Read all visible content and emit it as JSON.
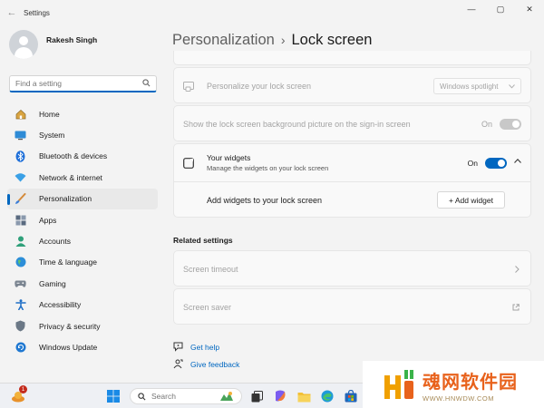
{
  "window": {
    "title": "Settings",
    "controls": [
      "—",
      "▢",
      "✕"
    ]
  },
  "user": {
    "name": "Rakesh Singh"
  },
  "search": {
    "placeholder": "Find a setting"
  },
  "sidebar": {
    "items": [
      {
        "label": "Home",
        "icon": "home-icon"
      },
      {
        "label": "System",
        "icon": "monitor-icon"
      },
      {
        "label": "Bluetooth & devices",
        "icon": "bluetooth-icon"
      },
      {
        "label": "Network & internet",
        "icon": "wifi-icon"
      },
      {
        "label": "Personalization",
        "icon": "brush-icon",
        "active": true
      },
      {
        "label": "Apps",
        "icon": "apps-icon"
      },
      {
        "label": "Accounts",
        "icon": "person-icon"
      },
      {
        "label": "Time & language",
        "icon": "globe-icon"
      },
      {
        "label": "Gaming",
        "icon": "gamepad-icon"
      },
      {
        "label": "Accessibility",
        "icon": "accessibility-icon"
      },
      {
        "label": "Privacy & security",
        "icon": "shield-icon"
      },
      {
        "label": "Windows Update",
        "icon": "update-icon"
      }
    ]
  },
  "breadcrumb": {
    "parent": "Personalization",
    "separator": "›",
    "current": "Lock screen"
  },
  "personalize": {
    "label": "Personalize your lock screen",
    "value": "Windows spotlight"
  },
  "background_signin": {
    "label": "Show the lock screen background picture on the sign-in screen",
    "state": "On"
  },
  "widgets": {
    "title": "Your widgets",
    "subtitle": "Manage the widgets on your lock screen",
    "state": "On",
    "add_label": "Add widgets to your lock screen",
    "add_button": "+ Add widget"
  },
  "related": {
    "title": "Related settings",
    "items": [
      {
        "label": "Screen timeout",
        "icon": "chevron-right-icon"
      },
      {
        "label": "Screen saver",
        "icon": "open-external-icon"
      }
    ]
  },
  "help": {
    "get_help": "Get help",
    "give_feedback": "Give feedback"
  },
  "taskbar": {
    "search_placeholder": "Search",
    "badge": "1"
  },
  "watermark": {
    "main": "魂网软件园",
    "sub": "WWW.HNWDW.COM"
  },
  "colors": {
    "accent": "#0067c0",
    "toggle_off": "#c8c8c8",
    "watermark_orange": "#e8621c"
  }
}
